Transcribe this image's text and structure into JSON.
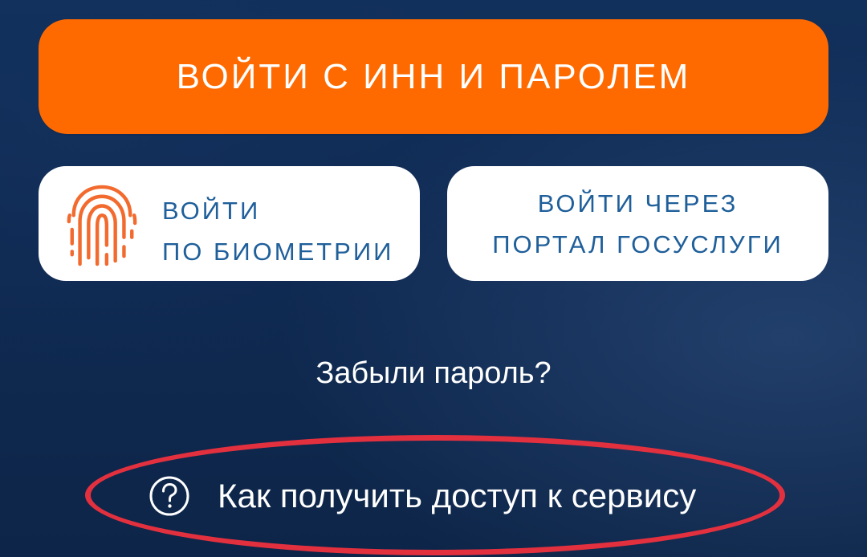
{
  "login": {
    "primary_label": "ВОЙТИ С ИНН И ПАРОЛЕМ",
    "biometry": {
      "line1": "ВОЙТИ",
      "line2": "ПО БИОМЕТРИИ",
      "icon": "fingerprint-icon"
    },
    "gosuslugi": {
      "line1": "ВОЙТИ ЧЕРЕЗ",
      "line2": "ПОРТАЛ ГОСУСЛУГИ"
    },
    "forgot_password": "Забыли пароль?",
    "access_help": {
      "label": "Как получить доступ к сервису",
      "icon": "question-circle-icon"
    }
  },
  "colors": {
    "background": "#0f2a52",
    "primary": "#ff6a00",
    "link_blue": "#1f5f9a",
    "highlight_ellipse": "#e3303f"
  }
}
